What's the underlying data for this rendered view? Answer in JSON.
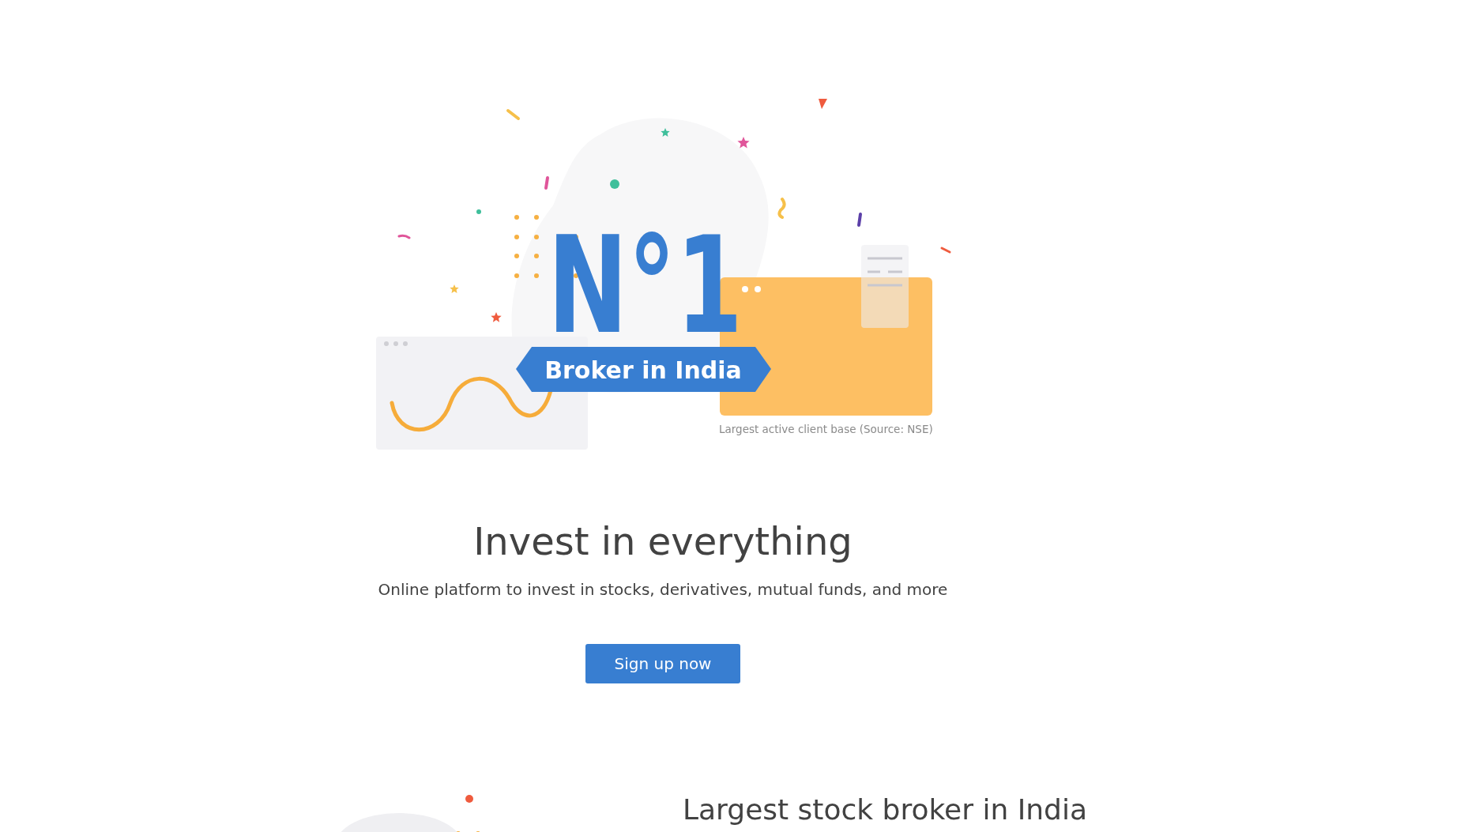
{
  "illustration": {
    "rank": "N°1",
    "banner": "Broker in India",
    "caption": "Largest active client base (Source: NSE)"
  },
  "hero": {
    "heading": "Invest in everything",
    "subheading": "Online platform to invest in stocks, derivatives, mutual funds, and more",
    "button": "Sign up now"
  },
  "next_section": {
    "heading": "Largest stock broker in India"
  }
}
